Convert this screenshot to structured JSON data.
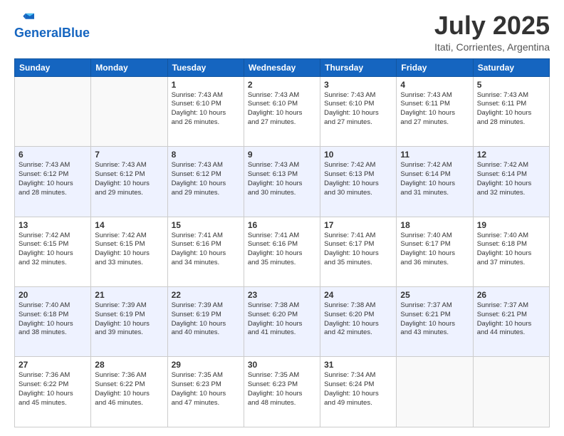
{
  "header": {
    "logo_line1": "General",
    "logo_line2": "Blue",
    "month_year": "July 2025",
    "location": "Itati, Corrientes, Argentina"
  },
  "days_of_week": [
    "Sunday",
    "Monday",
    "Tuesday",
    "Wednesday",
    "Thursday",
    "Friday",
    "Saturday"
  ],
  "weeks": [
    [
      {
        "day": "",
        "detail": ""
      },
      {
        "day": "",
        "detail": ""
      },
      {
        "day": "1",
        "detail": "Sunrise: 7:43 AM\nSunset: 6:10 PM\nDaylight: 10 hours\nand 26 minutes."
      },
      {
        "day": "2",
        "detail": "Sunrise: 7:43 AM\nSunset: 6:10 PM\nDaylight: 10 hours\nand 27 minutes."
      },
      {
        "day": "3",
        "detail": "Sunrise: 7:43 AM\nSunset: 6:10 PM\nDaylight: 10 hours\nand 27 minutes."
      },
      {
        "day": "4",
        "detail": "Sunrise: 7:43 AM\nSunset: 6:11 PM\nDaylight: 10 hours\nand 27 minutes."
      },
      {
        "day": "5",
        "detail": "Sunrise: 7:43 AM\nSunset: 6:11 PM\nDaylight: 10 hours\nand 28 minutes."
      }
    ],
    [
      {
        "day": "6",
        "detail": "Sunrise: 7:43 AM\nSunset: 6:12 PM\nDaylight: 10 hours\nand 28 minutes."
      },
      {
        "day": "7",
        "detail": "Sunrise: 7:43 AM\nSunset: 6:12 PM\nDaylight: 10 hours\nand 29 minutes."
      },
      {
        "day": "8",
        "detail": "Sunrise: 7:43 AM\nSunset: 6:12 PM\nDaylight: 10 hours\nand 29 minutes."
      },
      {
        "day": "9",
        "detail": "Sunrise: 7:43 AM\nSunset: 6:13 PM\nDaylight: 10 hours\nand 30 minutes."
      },
      {
        "day": "10",
        "detail": "Sunrise: 7:42 AM\nSunset: 6:13 PM\nDaylight: 10 hours\nand 30 minutes."
      },
      {
        "day": "11",
        "detail": "Sunrise: 7:42 AM\nSunset: 6:14 PM\nDaylight: 10 hours\nand 31 minutes."
      },
      {
        "day": "12",
        "detail": "Sunrise: 7:42 AM\nSunset: 6:14 PM\nDaylight: 10 hours\nand 32 minutes."
      }
    ],
    [
      {
        "day": "13",
        "detail": "Sunrise: 7:42 AM\nSunset: 6:15 PM\nDaylight: 10 hours\nand 32 minutes."
      },
      {
        "day": "14",
        "detail": "Sunrise: 7:42 AM\nSunset: 6:15 PM\nDaylight: 10 hours\nand 33 minutes."
      },
      {
        "day": "15",
        "detail": "Sunrise: 7:41 AM\nSunset: 6:16 PM\nDaylight: 10 hours\nand 34 minutes."
      },
      {
        "day": "16",
        "detail": "Sunrise: 7:41 AM\nSunset: 6:16 PM\nDaylight: 10 hours\nand 35 minutes."
      },
      {
        "day": "17",
        "detail": "Sunrise: 7:41 AM\nSunset: 6:17 PM\nDaylight: 10 hours\nand 35 minutes."
      },
      {
        "day": "18",
        "detail": "Sunrise: 7:40 AM\nSunset: 6:17 PM\nDaylight: 10 hours\nand 36 minutes."
      },
      {
        "day": "19",
        "detail": "Sunrise: 7:40 AM\nSunset: 6:18 PM\nDaylight: 10 hours\nand 37 minutes."
      }
    ],
    [
      {
        "day": "20",
        "detail": "Sunrise: 7:40 AM\nSunset: 6:18 PM\nDaylight: 10 hours\nand 38 minutes."
      },
      {
        "day": "21",
        "detail": "Sunrise: 7:39 AM\nSunset: 6:19 PM\nDaylight: 10 hours\nand 39 minutes."
      },
      {
        "day": "22",
        "detail": "Sunrise: 7:39 AM\nSunset: 6:19 PM\nDaylight: 10 hours\nand 40 minutes."
      },
      {
        "day": "23",
        "detail": "Sunrise: 7:38 AM\nSunset: 6:20 PM\nDaylight: 10 hours\nand 41 minutes."
      },
      {
        "day": "24",
        "detail": "Sunrise: 7:38 AM\nSunset: 6:20 PM\nDaylight: 10 hours\nand 42 minutes."
      },
      {
        "day": "25",
        "detail": "Sunrise: 7:37 AM\nSunset: 6:21 PM\nDaylight: 10 hours\nand 43 minutes."
      },
      {
        "day": "26",
        "detail": "Sunrise: 7:37 AM\nSunset: 6:21 PM\nDaylight: 10 hours\nand 44 minutes."
      }
    ],
    [
      {
        "day": "27",
        "detail": "Sunrise: 7:36 AM\nSunset: 6:22 PM\nDaylight: 10 hours\nand 45 minutes."
      },
      {
        "day": "28",
        "detail": "Sunrise: 7:36 AM\nSunset: 6:22 PM\nDaylight: 10 hours\nand 46 minutes."
      },
      {
        "day": "29",
        "detail": "Sunrise: 7:35 AM\nSunset: 6:23 PM\nDaylight: 10 hours\nand 47 minutes."
      },
      {
        "day": "30",
        "detail": "Sunrise: 7:35 AM\nSunset: 6:23 PM\nDaylight: 10 hours\nand 48 minutes."
      },
      {
        "day": "31",
        "detail": "Sunrise: 7:34 AM\nSunset: 6:24 PM\nDaylight: 10 hours\nand 49 minutes."
      },
      {
        "day": "",
        "detail": ""
      },
      {
        "day": "",
        "detail": ""
      }
    ]
  ]
}
